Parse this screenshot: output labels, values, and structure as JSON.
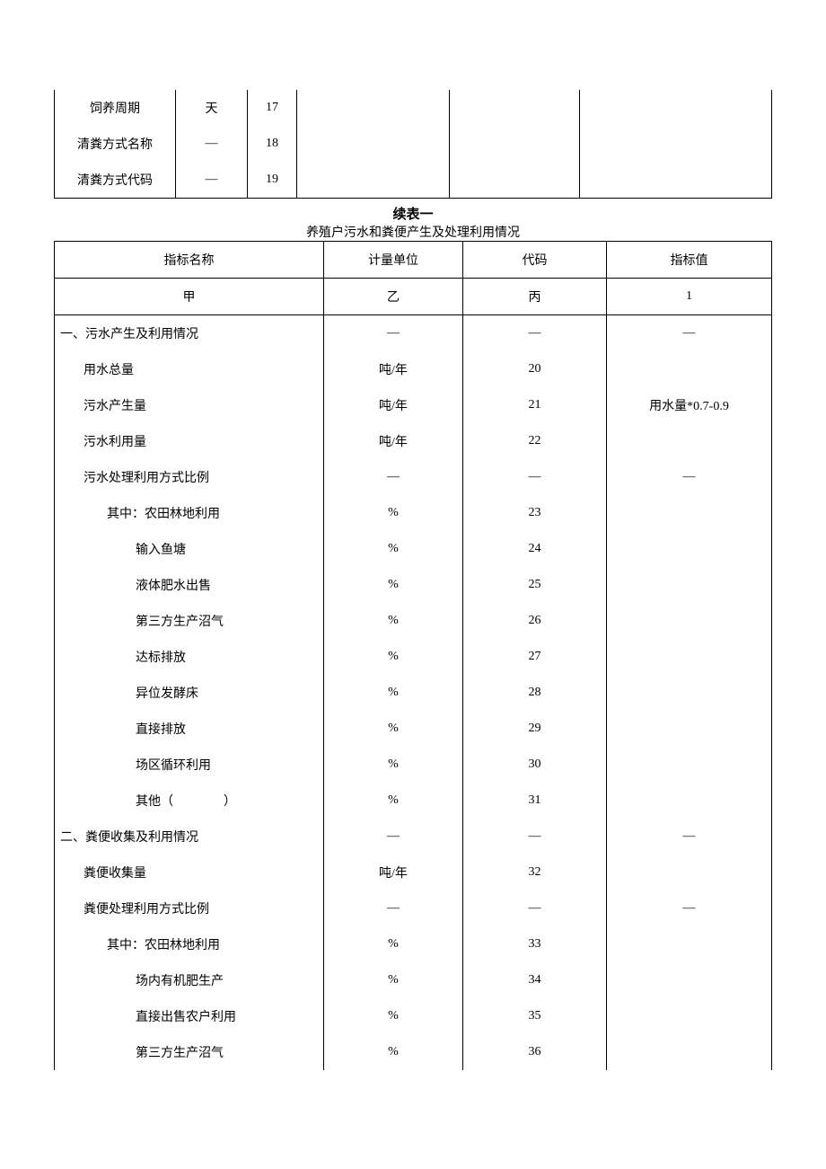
{
  "table1": {
    "rows": [
      {
        "name": "饲养周期",
        "unit": "天",
        "code": "17",
        "v1": "",
        "v2": "",
        "v3": ""
      },
      {
        "name": "清粪方式名称",
        "unit": "—",
        "code": "18",
        "v1": "",
        "v2": "",
        "v3": ""
      },
      {
        "name": "清粪方式代码",
        "unit": "—",
        "code": "19",
        "v1": "",
        "v2": "",
        "v3": ""
      }
    ]
  },
  "section": {
    "title": "续表一",
    "subtitle": "养殖户污水和粪便产生及处理利用情况"
  },
  "table2": {
    "header": {
      "a": "指标名称",
      "b": "计量单位",
      "c": "代码",
      "d": "指标值"
    },
    "header2": {
      "a": "甲",
      "b": "乙",
      "c": "丙",
      "d": "1"
    },
    "rows": [
      {
        "a": "一、污水产生及利用情况",
        "b": "—",
        "c": "—",
        "d": "—",
        "cls": "left"
      },
      {
        "a": "用水总量",
        "b": "吨/年",
        "c": "20",
        "d": "",
        "cls": "indent1"
      },
      {
        "a": "污水产生量",
        "b": "吨/年",
        "c": "21",
        "d": "用水量*0.7-0.9",
        "cls": "indent1"
      },
      {
        "a": "污水利用量",
        "b": "吨/年",
        "c": "22",
        "d": "",
        "cls": "indent1"
      },
      {
        "a": "污水处理利用方式比例",
        "b": "—",
        "c": "—",
        "d": "—",
        "cls": "indent1"
      },
      {
        "a": "其中：农田林地利用",
        "b": "%",
        "c": "23",
        "d": "",
        "cls": "indent2"
      },
      {
        "a": "输入鱼塘",
        "b": "%",
        "c": "24",
        "d": "",
        "cls": "indent3"
      },
      {
        "a": "液体肥水出售",
        "b": "%",
        "c": "25",
        "d": "",
        "cls": "indent3"
      },
      {
        "a": "第三方生产沼气",
        "b": "%",
        "c": "26",
        "d": "",
        "cls": "indent3"
      },
      {
        "a": "达标排放",
        "b": "%",
        "c": "27",
        "d": "",
        "cls": "indent3"
      },
      {
        "a": "异位发酵床",
        "b": "%",
        "c": "28",
        "d": "",
        "cls": "indent3"
      },
      {
        "a": "直接排放",
        "b": "%",
        "c": "29",
        "d": "",
        "cls": "indent3"
      },
      {
        "a": "场区循环利用",
        "b": "%",
        "c": "30",
        "d": "",
        "cls": "indent3"
      },
      {
        "a": "其他（　　　　）",
        "b": "%",
        "c": "31",
        "d": "",
        "cls": "indent3"
      },
      {
        "a": "二、粪便收集及利用情况",
        "b": "—",
        "c": "—",
        "d": "—",
        "cls": "left"
      },
      {
        "a": "粪便收集量",
        "b": "吨/年",
        "c": "32",
        "d": "",
        "cls": "indent1"
      },
      {
        "a": "粪便处理利用方式比例",
        "b": "—",
        "c": "—",
        "d": "—",
        "cls": "indent1"
      },
      {
        "a": "其中：农田林地利用",
        "b": "%",
        "c": "33",
        "d": "",
        "cls": "indent2"
      },
      {
        "a": "场内有机肥生产",
        "b": "%",
        "c": "34",
        "d": "",
        "cls": "indent3"
      },
      {
        "a": "直接出售农户利用",
        "b": "%",
        "c": "35",
        "d": "",
        "cls": "indent3"
      },
      {
        "a": "第三方生产沼气",
        "b": "%",
        "c": "36",
        "d": "",
        "cls": "indent3"
      }
    ]
  }
}
